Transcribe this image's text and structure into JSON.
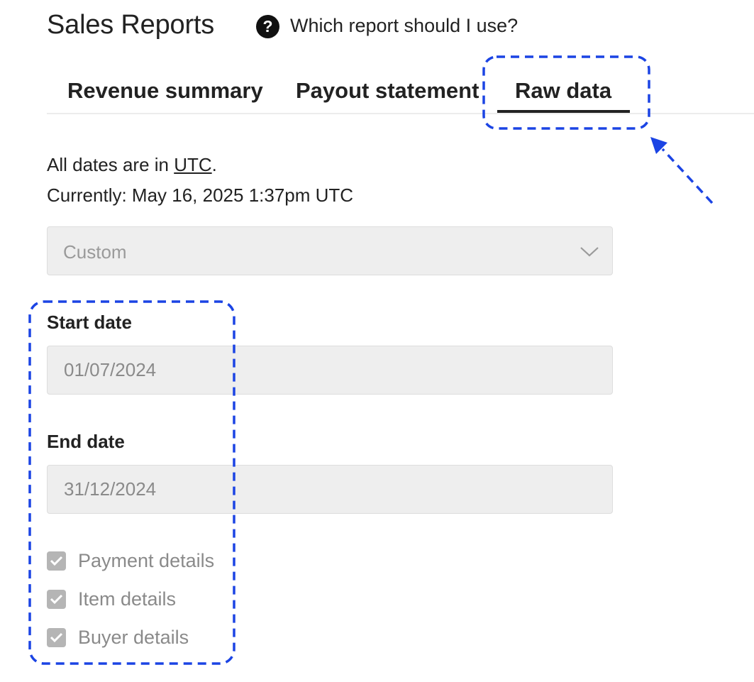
{
  "header": {
    "title": "Sales Reports",
    "help_icon": "question-circle-icon",
    "help_link": "Which report should I use?"
  },
  "tabs": [
    {
      "label": "Revenue summary",
      "active": false
    },
    {
      "label": "Payout statement",
      "active": false
    },
    {
      "label": "Raw data",
      "active": true
    }
  ],
  "info": {
    "prefix": "All dates are in ",
    "utc_link": "UTC",
    "suffix": ".",
    "current": "Currently: May 16, 2025 1:37pm UTC"
  },
  "range_select": {
    "value": "Custom",
    "icon": "chevron-down-icon"
  },
  "start_date": {
    "label": "Start date",
    "value": "01/07/2024"
  },
  "end_date": {
    "label": "End date",
    "value": "31/12/2024"
  },
  "options": [
    {
      "label": "Payment details",
      "checked": true
    },
    {
      "label": "Item details",
      "checked": true
    },
    {
      "label": "Buyer details",
      "checked": true
    }
  ],
  "colors": {
    "annotation": "#1b44e4",
    "disabled_field": "#eeeeee",
    "text": "#222222",
    "disabled_text": "#8a8a8a"
  }
}
